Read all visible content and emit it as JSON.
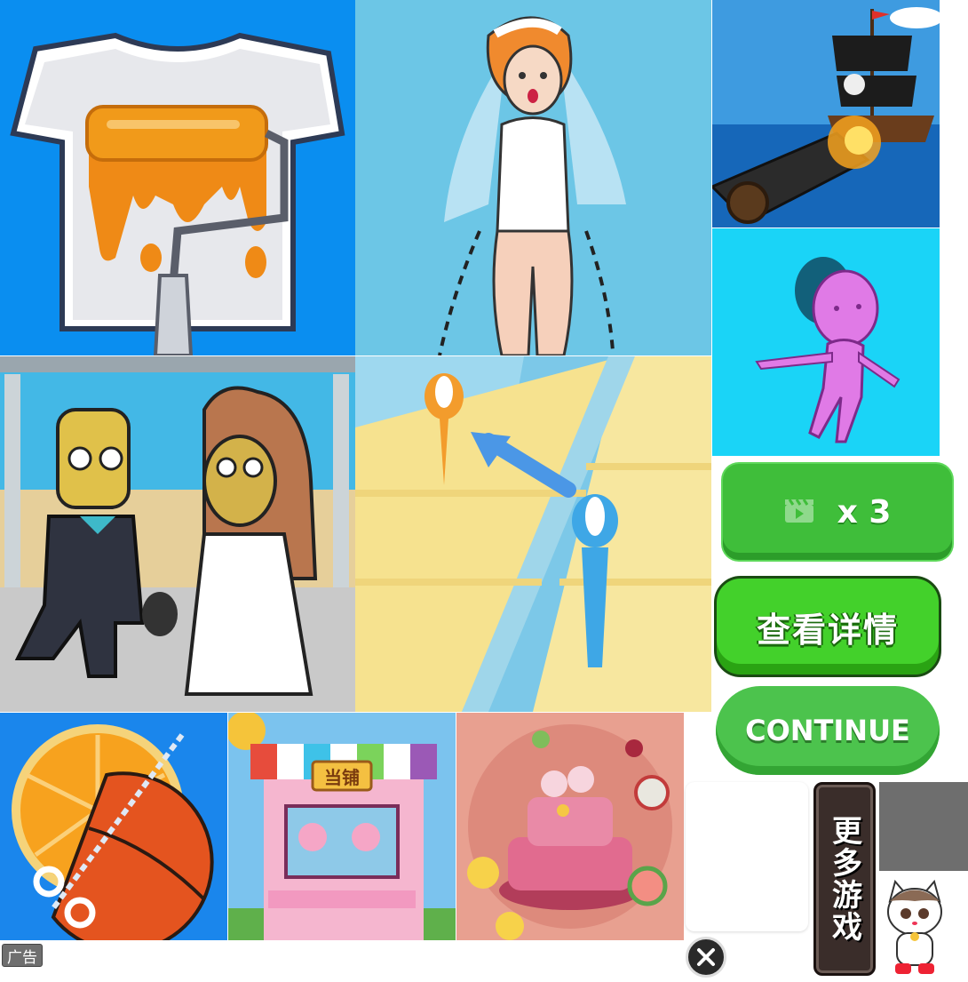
{
  "buttons": {
    "video_multiplier": "x 3",
    "details": "查看详情",
    "continue": "CONTINUE",
    "more_games": "更多游戏"
  },
  "ad_label": "广告",
  "shop_sign": "当铺",
  "colors": {
    "button_green": "#43d12b",
    "continue_green": "#4cc34d",
    "more_games_bg": "#3a2d2a"
  },
  "icons": {
    "video": "clapperboard-icon",
    "close": "close-x-icon"
  }
}
